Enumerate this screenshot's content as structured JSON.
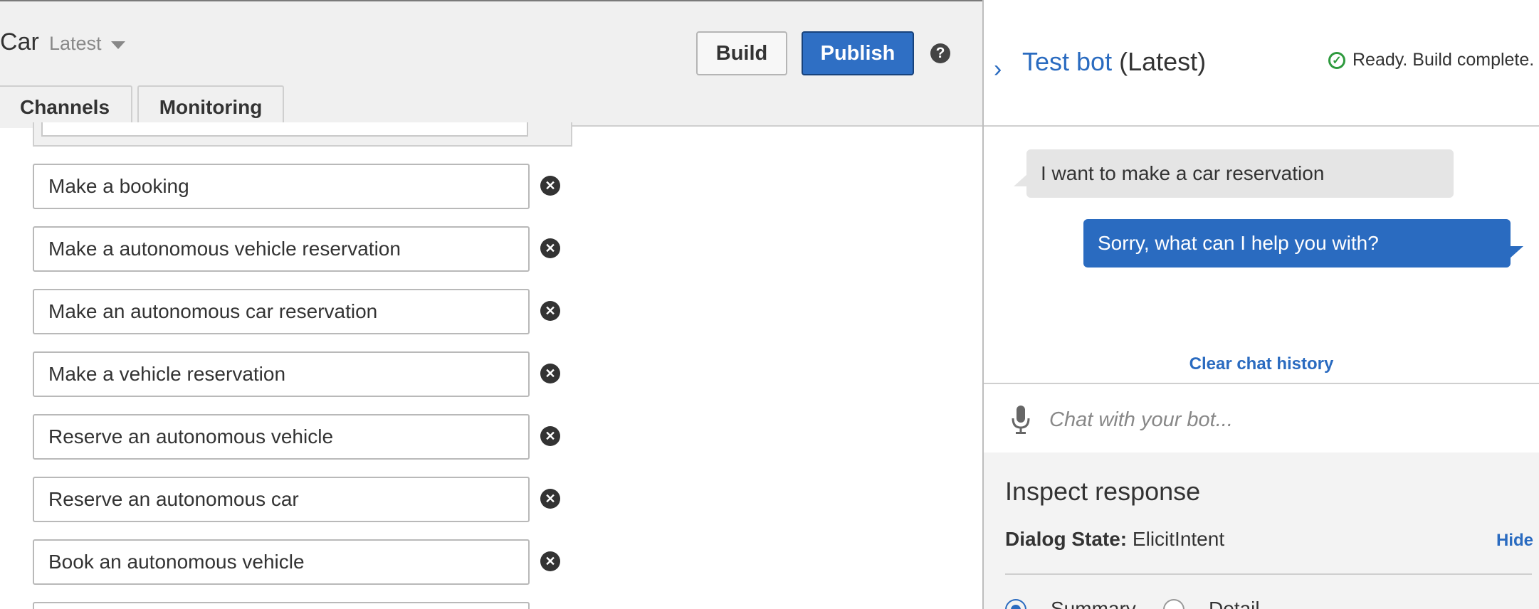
{
  "header": {
    "bot_name": "Car",
    "version": "Latest",
    "build_label": "Build",
    "publish_label": "Publish",
    "help_symbol": "?",
    "tabs": [
      {
        "label": "Channels"
      },
      {
        "label": "Monitoring"
      }
    ]
  },
  "utterances": [
    {
      "text": "Make a booking"
    },
    {
      "text": "Make a autonomous vehicle reservation"
    },
    {
      "text": "Make an autonomous car reservation"
    },
    {
      "text": "Make a vehicle reservation"
    },
    {
      "text": "Reserve an autonomous vehicle"
    },
    {
      "text": "Reserve an autonomous car"
    },
    {
      "text": "Book an autonomous vehicle"
    }
  ],
  "test_bot": {
    "title": "Test bot",
    "version_suffix": "(Latest)",
    "status": "Ready. Build complete.",
    "messages": [
      {
        "from": "user",
        "text": "I want to make a car reservation"
      },
      {
        "from": "bot",
        "text": "Sorry, what can I help you with?"
      }
    ],
    "clear_history_label": "Clear chat history",
    "input_placeholder": "Chat with your bot..."
  },
  "inspect_response": {
    "title": "Inspect response",
    "dialog_state_label": "Dialog State:",
    "dialog_state_value": "ElicitIntent",
    "hide_label": "Hide",
    "view_options": [
      {
        "label": "Summary",
        "selected": true
      },
      {
        "label": "Detail",
        "selected": false
      }
    ]
  },
  "colors": {
    "accent": "#2a6bc0",
    "publish_bg": "#2f6fc4",
    "success": "#2e9a3e",
    "panel_gray": "#f0f0f0"
  },
  "icons": {
    "caret": "chevron-down-icon",
    "help": "help-icon",
    "remove": "remove-icon",
    "expand": "chevron-right-icon",
    "status": "check-circle-icon",
    "mic": "microphone-icon"
  }
}
